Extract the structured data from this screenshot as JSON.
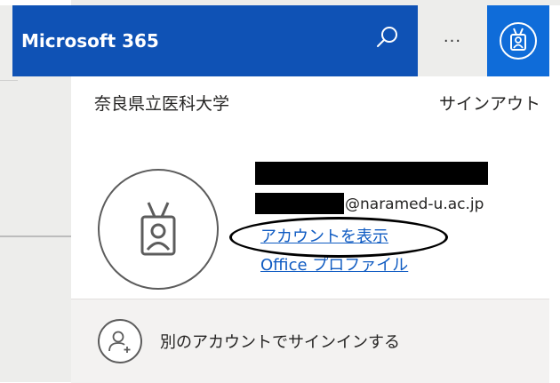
{
  "header": {
    "brand": "Microsoft 365",
    "search_icon": "search-icon",
    "more_label": "···",
    "avatar_icon": "badge-icon",
    "colors": {
      "bar": "#0f52b5",
      "avatar_bg": "#0f6cd9"
    }
  },
  "account_panel": {
    "organization": "奈良県立医科大学",
    "sign_out": "サインアウト",
    "email_domain": "@naramed-u.ac.jp",
    "view_account": "アカウントを表示",
    "office_profile": "Office プロファイル",
    "avatar_icon": "badge-icon"
  },
  "footer": {
    "add_account_icon": "add-person-icon",
    "add_account_label": "別のアカウントでサインインする"
  }
}
